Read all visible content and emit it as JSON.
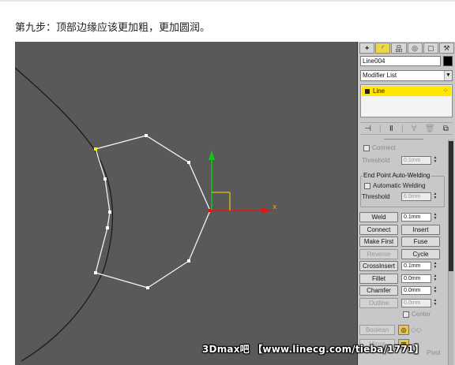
{
  "caption": "第九步：顶部边缘应该更加粗，更加圆润。",
  "viewport": {
    "axis_labels": {
      "x": "x"
    }
  },
  "command_panel": {
    "tabs": [
      {
        "icon": "create-icon",
        "glyph": "✦"
      },
      {
        "icon": "modify-icon",
        "glyph": "◜"
      },
      {
        "icon": "hierarchy-icon",
        "glyph": "品"
      },
      {
        "icon": "motion-icon",
        "glyph": "◎"
      },
      {
        "icon": "display-icon",
        "glyph": "▢"
      },
      {
        "icon": "utilities-icon",
        "glyph": "⚒"
      }
    ],
    "object_name": "Line004",
    "object_color": "#000000",
    "modifier_list": "Modifier List",
    "stack_item": "Line",
    "stack_tools": [
      "⊣",
      "|",
      "Ⅱ",
      "|",
      "∀",
      "🗑",
      "⧉"
    ],
    "geometry": {
      "connect_label": "Connect",
      "threshold_label": "Threshold",
      "threshold_value": "0.1mm"
    },
    "auto_weld": {
      "group_title": "End Point Auto-Welding",
      "automatic_label": "Automatic Welding",
      "threshold_label": "Threshold",
      "threshold_value": "6.0mm"
    },
    "buttons": {
      "weld": "Weld",
      "weld_value": "0.1mm",
      "connect": "Connect",
      "insert": "Insert",
      "make_first": "Make First",
      "fuse": "Fuse",
      "reverse": "Reverse",
      "cycle": "Cycle",
      "cross_insert": "CrossInsert",
      "cross_insert_value": "0.1mm",
      "fillet": "Fillet",
      "fillet_value": "0.0mm",
      "chamfer": "Chamfer",
      "chamfer_value": "0.0mm",
      "outline": "Outline",
      "outline_value": "0.0mm",
      "center": "Center",
      "boolean": "Boolean",
      "mirror": "Mirror",
      "pivot": "Pivot"
    }
  },
  "watermark": "3Dmax吧  【www.linecg.com/tieba/1771】"
}
